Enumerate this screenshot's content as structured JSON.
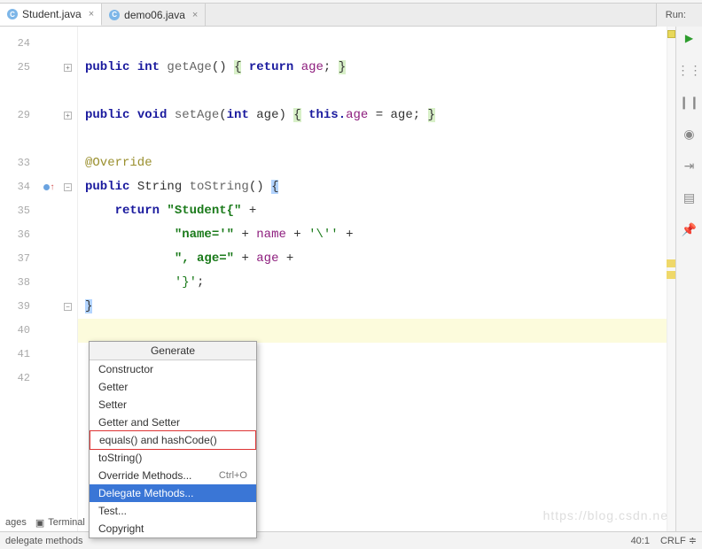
{
  "tabs": [
    {
      "label": "Student.java",
      "active": true
    },
    {
      "label": "demo06.java",
      "active": false
    }
  ],
  "run": {
    "label": "Run:"
  },
  "lineNumbers": [
    "24",
    "25",
    "",
    "29",
    "",
    "33",
    "34",
    "35",
    "36",
    "37",
    "38",
    "39",
    "40",
    "41",
    "42"
  ],
  "code": {
    "l24": "",
    "l25_a": "public ",
    "l25_b": "int ",
    "l25_c": "getAge",
    "l25_d": "() ",
    "l25_e": "{",
    "l25_f": " return ",
    "l25_g": "age",
    "l25_h": "; ",
    "l25_i": "}",
    "blank1": "",
    "l29_a": "public ",
    "l29_b": "void ",
    "l29_c": "setAge",
    "l29_d": "(",
    "l29_e": "int ",
    "l29_f": "age) ",
    "l29_g": "{",
    "l29_h": " this.",
    "l29_i": "age",
    "l29_j": " = age; ",
    "l29_k": "}",
    "blank2": "",
    "l33": "@Override",
    "l34_a": "public ",
    "l34_b": "String ",
    "l34_c": "toString",
    "l34_d": "() ",
    "l34_e": "{",
    "l35_a": "    return ",
    "l35_b": "\"Student{\"",
    "l35_c": " +",
    "l36_a": "            ",
    "l36_b": "\"name='\"",
    "l36_c": " + ",
    "l36_d": "name",
    "l36_e": " + ",
    "l36_f": "'\\''",
    "l36_g": " +",
    "l37_a": "            ",
    "l37_b": "\", age=\"",
    "l37_c": " + ",
    "l37_d": "age",
    "l37_e": " +",
    "l38_a": "            ",
    "l38_b": "'}'",
    "l38_c": ";",
    "l39": "}",
    "l40": "",
    "l41": "",
    "l42": ""
  },
  "generateMenu": {
    "title": "Generate",
    "items": [
      {
        "label": "Constructor"
      },
      {
        "label": "Getter"
      },
      {
        "label": "Setter"
      },
      {
        "label": "Getter and Setter"
      },
      {
        "label": "equals() and hashCode()",
        "redbox": true
      },
      {
        "label": "toString()"
      },
      {
        "label": "Override Methods...",
        "shortcut": "Ctrl+O"
      },
      {
        "label": "Delegate Methods...",
        "selected": true
      },
      {
        "label": "Test..."
      },
      {
        "label": "Copyright"
      }
    ]
  },
  "bottomTabs": {
    "ages": "ages",
    "term": "Terminal"
  },
  "statusBar": {
    "left": "delegate methods",
    "pos": "40:1",
    "enc": "CRLF"
  },
  "watermark": "https://blog.csdn.ne"
}
